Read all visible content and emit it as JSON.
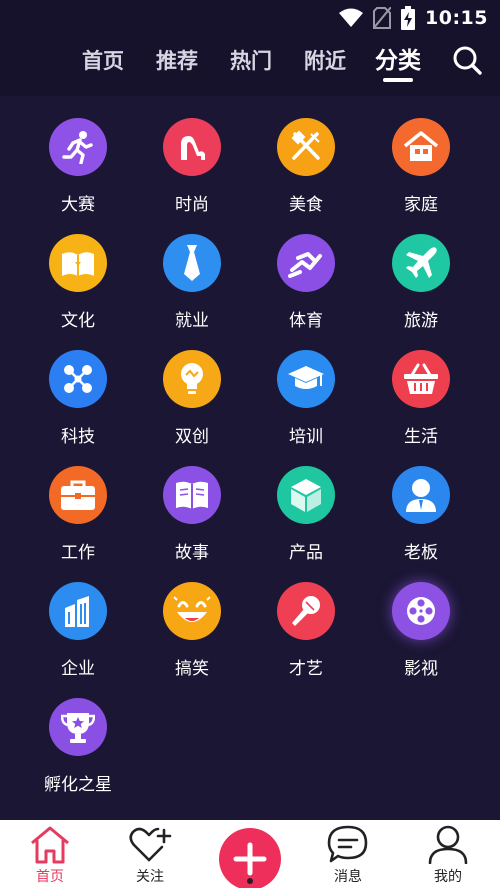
{
  "status": {
    "time": "10:15",
    "icons": [
      "wifi-icon",
      "no-sim-icon",
      "battery-charging-icon"
    ]
  },
  "top_nav": {
    "tabs": [
      {
        "label": "首页",
        "active": false
      },
      {
        "label": "推荐",
        "active": false
      },
      {
        "label": "热门",
        "active": false
      },
      {
        "label": "附近",
        "active": false
      },
      {
        "label": "分类",
        "active": true
      }
    ],
    "search_icon": "search-icon"
  },
  "categories": [
    {
      "label": "大赛",
      "icon": "running-man-icon",
      "color": "#8f52e6"
    },
    {
      "label": "时尚",
      "icon": "high-heel-icon",
      "color": "#ec3d5a"
    },
    {
      "label": "美食",
      "icon": "fork-knife-icon",
      "color": "#f7a214"
    },
    {
      "label": "家庭",
      "icon": "house-icon",
      "color": "#f46a2e"
    },
    {
      "label": "文化",
      "icon": "open-book-icon",
      "color": "#f7b316"
    },
    {
      "label": "就业",
      "icon": "necktie-icon",
      "color": "#2f8ff0"
    },
    {
      "label": "体育",
      "icon": "sprinter-icon",
      "color": "#8c4fe6"
    },
    {
      "label": "旅游",
      "icon": "airplane-icon",
      "color": "#1fc7a2"
    },
    {
      "label": "科技",
      "icon": "molecule-icon",
      "color": "#2c7ff2"
    },
    {
      "label": "双创",
      "icon": "lightbulb-icon",
      "color": "#f7a816"
    },
    {
      "label": "培训",
      "icon": "graduation-cap-icon",
      "color": "#2a8cf0"
    },
    {
      "label": "生活",
      "icon": "shopping-basket-icon",
      "color": "#ee3f4f"
    },
    {
      "label": "工作",
      "icon": "briefcase-icon",
      "color": "#f36a26"
    },
    {
      "label": "故事",
      "icon": "story-book-icon",
      "color": "#8a51e4"
    },
    {
      "label": "产品",
      "icon": "cube-icon",
      "color": "#1fc7a0"
    },
    {
      "label": "老板",
      "icon": "boss-avatar-icon",
      "color": "#2b86ee"
    },
    {
      "label": "企业",
      "icon": "buildings-icon",
      "color": "#2d8cf0"
    },
    {
      "label": "搞笑",
      "icon": "laughing-face-icon",
      "color": "#f7a614"
    },
    {
      "label": "才艺",
      "icon": "microphone-icon",
      "color": "#ee4052"
    },
    {
      "label": "影视",
      "icon": "film-reel-icon",
      "color": "#8d52e4"
    },
    {
      "label": "孵化之星",
      "icon": "trophy-star-icon",
      "color": "#8a4fe3"
    }
  ],
  "bottom_nav": {
    "items": [
      {
        "label": "首页",
        "icon": "home-icon",
        "active": true
      },
      {
        "label": "关注",
        "icon": "heart-plus-icon",
        "active": false
      },
      {
        "label": "消息",
        "icon": "chat-bubble-icon",
        "active": false
      },
      {
        "label": "我的",
        "icon": "profile-icon",
        "active": false
      }
    ],
    "add_icon": "plus-icon",
    "accent": "#ee2f5c"
  }
}
